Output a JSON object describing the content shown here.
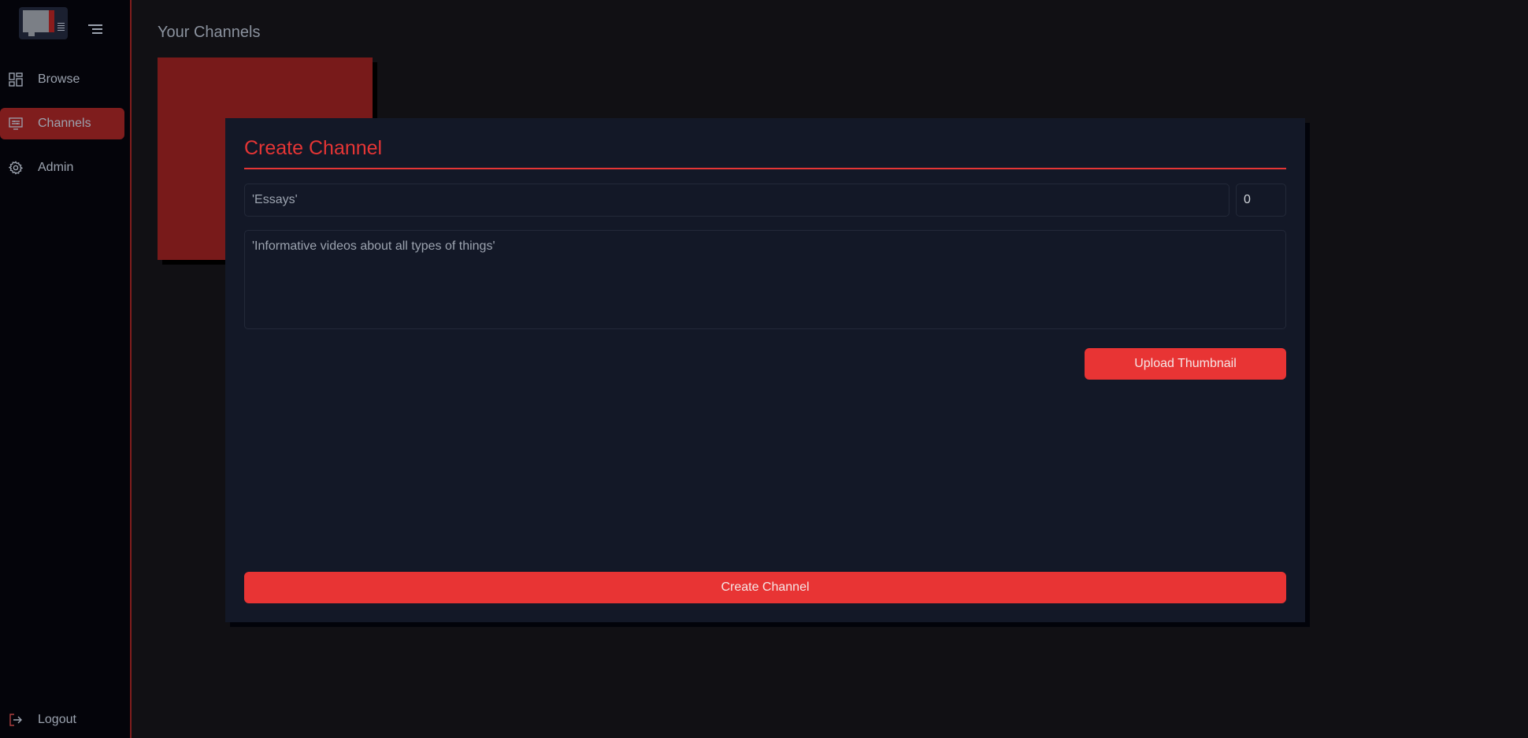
{
  "sidebar": {
    "logo": "app-logo",
    "menu_toggle_icon": "menu-icon",
    "items": [
      {
        "label": "Browse",
        "icon": "grid-icon",
        "active": false
      },
      {
        "label": "Channels",
        "icon": "monitor-icon",
        "active": true
      },
      {
        "label": "Admin",
        "icon": "gear-icon",
        "active": false
      }
    ],
    "logout": {
      "label": "Logout",
      "icon": "logout-icon"
    }
  },
  "main": {
    "title": "Your Channels"
  },
  "modal": {
    "title": "Create Channel",
    "name_value": "'Essays'",
    "number_value": "0",
    "description_value": "'Informative videos about all types of things'",
    "upload_label": "Upload Thumbnail",
    "create_label": "Create Channel"
  },
  "colors": {
    "accent": "#e83434",
    "active_nav": "#7f1d1d",
    "card": "#781a1a",
    "modal_bg": "#131827",
    "page_bg": "#111014",
    "sidebar_bg": "#04040a"
  }
}
